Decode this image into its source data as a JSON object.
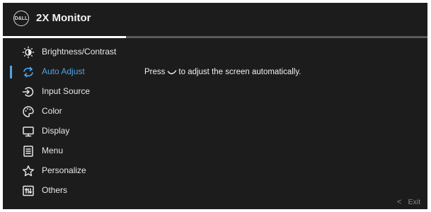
{
  "header": {
    "logo_text": "D&LL",
    "title": "2X Monitor",
    "progress": 0.29
  },
  "menu": {
    "items": [
      {
        "label": "Brightness/Contrast",
        "icon": "brightness-icon",
        "active": false
      },
      {
        "label": "Auto Adjust",
        "icon": "auto-adjust-icon",
        "active": true
      },
      {
        "label": "Input Source",
        "icon": "input-source-icon",
        "active": false
      },
      {
        "label": "Color",
        "icon": "color-palette-icon",
        "active": false
      },
      {
        "label": "Display",
        "icon": "display-icon",
        "active": false
      },
      {
        "label": "Menu",
        "icon": "menu-icon",
        "active": false
      },
      {
        "label": "Personalize",
        "icon": "star-icon",
        "active": false
      },
      {
        "label": "Others",
        "icon": "others-icon",
        "active": false
      }
    ]
  },
  "content": {
    "message_before": "Press",
    "message_after": "to adjust the screen automatically."
  },
  "footer": {
    "exit_chevron": "<",
    "exit_label": "Exit"
  },
  "colors": {
    "background": "#1c1c1c",
    "accent": "#4fa4e8",
    "text": "#e8e8e8",
    "muted": "#8a8a8a"
  }
}
